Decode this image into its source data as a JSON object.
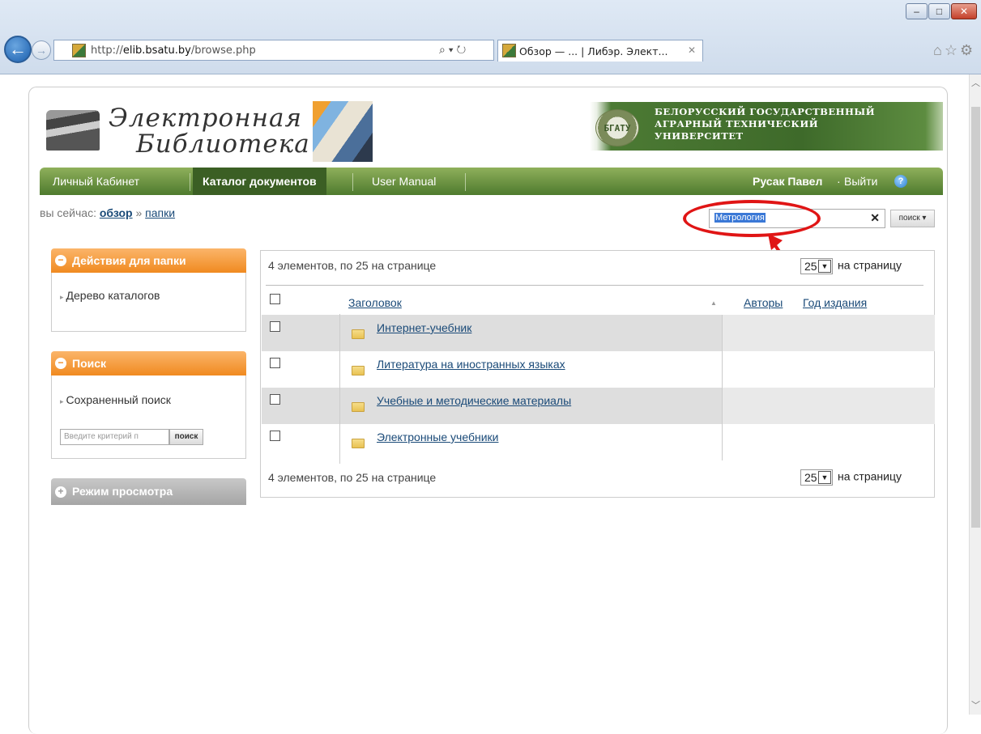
{
  "browser": {
    "url_prefix": "http://",
    "url_domain": "elib.bsatu.by",
    "url_path": "/browse.php",
    "address_icons": "⌕ ▾ ↻",
    "tab_title": "Обзор — ... | Либэр. Элект...",
    "tab_close": "✕",
    "window_minimize": "–",
    "window_maximize": "□",
    "window_close": "✕",
    "back_glyph": "←",
    "forward_glyph": "→",
    "toolbar_icons": "⌂☆⚙"
  },
  "header": {
    "logo_line1": "Электронная",
    "logo_line2": "Библиотека",
    "university_abbr": "БГАТУ",
    "university_lines": [
      "БЕЛОРУССКИЙ ГОСУДАРСТВЕННЫЙ",
      "АГРАРНЫЙ ТЕХНИЧЕСКИЙ",
      "УНИВЕРСИТЕТ"
    ]
  },
  "nav": {
    "cabinet": "Личный Кабинет",
    "catalog": "Каталог документов",
    "manual": "User Manual",
    "user": "Русак Павел",
    "separator": "·",
    "logout": "Выйти",
    "help": "?"
  },
  "breadcrumb": {
    "prefix": "вы сейчас:",
    "browse": "обзор",
    "sep": "»",
    "folders": "папки"
  },
  "search": {
    "value": "Метрология",
    "clear": "✕",
    "button": "поиск ▾"
  },
  "sidebar": {
    "folder_actions": {
      "title": "Действия для папки",
      "toggle": "−",
      "links": [
        "Дерево каталогов"
      ]
    },
    "search_box": {
      "title": "Поиск",
      "toggle": "−",
      "saved_search": "Сохраненный поиск",
      "input_placeholder": "Введите критерий п",
      "button": "поиск"
    },
    "view_mode": {
      "title": "Режим просмотра",
      "toggle": "+"
    }
  },
  "listing": {
    "summary_top": "4 элементов, по 25 на странице",
    "summary_bottom": "4 элементов, по 25 на странице",
    "per_page_value": "25",
    "per_page_label": "на страницу",
    "dropdown_arrow": "▼",
    "sort_arrow": "▲",
    "columns": {
      "title": "Заголовок",
      "authors": "Авторы",
      "year": "Год издания"
    },
    "rows": [
      {
        "title": "Интернет-учебник"
      },
      {
        "title": "Литература на иностранных языках"
      },
      {
        "title": "Учебные и методические материалы"
      },
      {
        "title": "Электронные учебники"
      }
    ]
  },
  "colors": {
    "nav_green": "#4e7a2e",
    "accent_orange": "#f08a20",
    "link_blue": "#1a4a78",
    "annotation_red": "#e01515"
  }
}
